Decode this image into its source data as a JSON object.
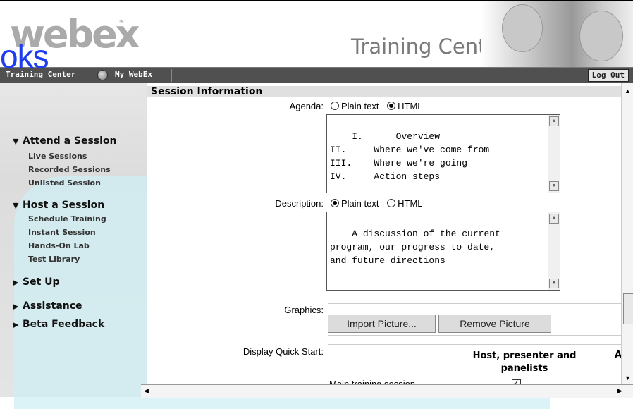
{
  "header": {
    "logo_text": "webex",
    "logo_tm": "™",
    "overlay_text": "oks",
    "product_title": "Training Center"
  },
  "navbar": {
    "training_center": "Training Center",
    "my_webex": "My WebEx",
    "logout": "Log Out"
  },
  "sidebar": {
    "sections": [
      {
        "label": "Attend a Session",
        "expanded": true,
        "links": [
          "Live Sessions",
          "Recorded Sessions",
          "Unlisted Session"
        ]
      },
      {
        "label": "Host a Session",
        "expanded": true,
        "links": [
          "Schedule Training",
          "Instant Session",
          "Hands-On Lab",
          "Test Library"
        ]
      },
      {
        "label": "Set Up",
        "expanded": false,
        "links": []
      },
      {
        "label": "Assistance",
        "expanded": false,
        "links": []
      },
      {
        "label": "Beta Feedback",
        "expanded": false,
        "links": []
      }
    ]
  },
  "main": {
    "section_title": "Session Information",
    "agenda": {
      "label": "Agenda:",
      "option_plain": "Plain text",
      "option_html": "HTML",
      "selected": "HTML",
      "text": "I.      Overview\nII.     Where we've come from\nIII.    Where we're going\nIV.     Action steps"
    },
    "description": {
      "label": "Description:",
      "option_plain": "Plain text",
      "option_html": "HTML",
      "selected": "Plain text",
      "text": "A discussion of the current\nprogram, our progress to date,\nand future directions"
    },
    "graphics": {
      "label": "Graphics:",
      "import_button": "Import Picture...",
      "remove_button": "Remove Picture"
    },
    "quick_start": {
      "label": "Display Quick Start:",
      "col_host": "Host, presenter and panelists",
      "col_attendees_partial": "At",
      "row_label": "Main training session",
      "checked": true
    }
  },
  "colors": {
    "navbar": "#505050",
    "overlay_text": "#1f3df0",
    "watermark": "#cfeff3"
  }
}
